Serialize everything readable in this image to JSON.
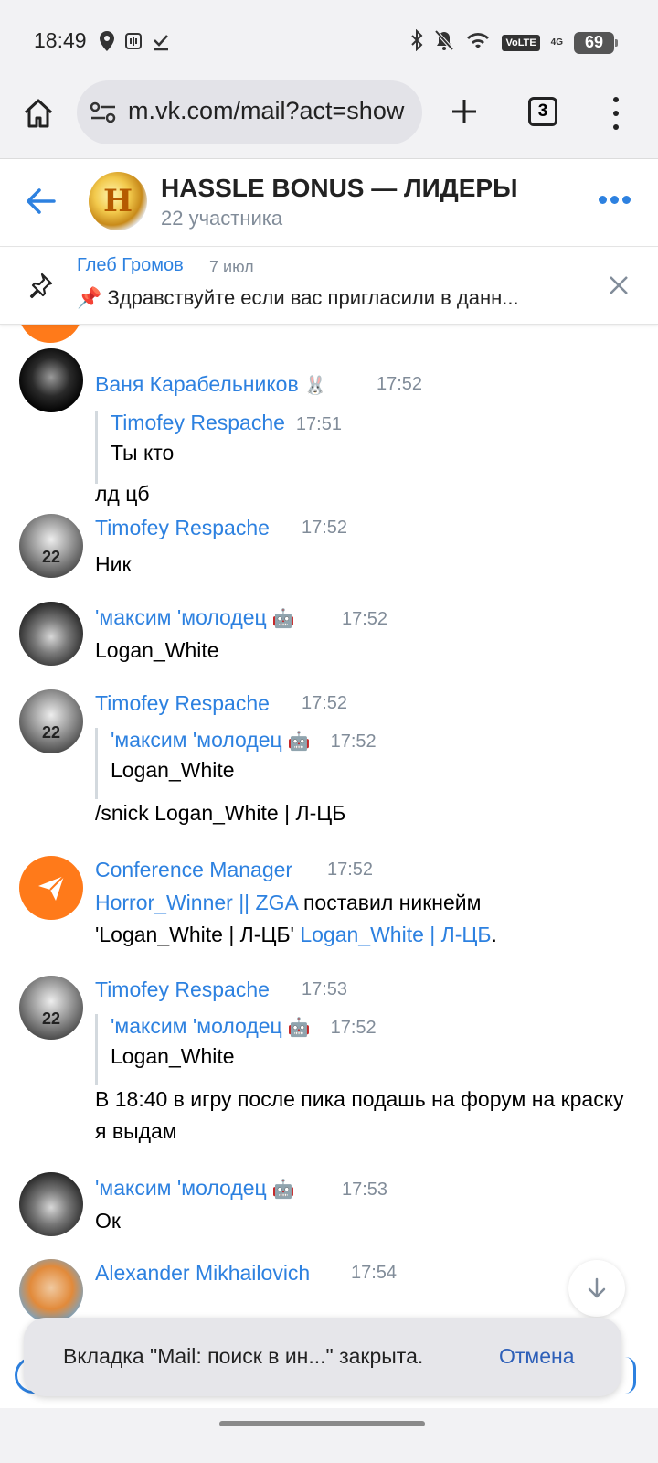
{
  "status_bar": {
    "time": "18:49",
    "volte": "VoLTE",
    "network": "4G",
    "battery": "69"
  },
  "browser": {
    "url": "m.vk.com/mail?act=show",
    "tab_count": "3"
  },
  "chat": {
    "title": "HASSLE BONUS — ЛИДЕРЫ",
    "subtitle": "22 участника",
    "avatar_letter": "H"
  },
  "pinned": {
    "author": "Глеб Громов",
    "date": "7 июл",
    "text": "📌 Здравствуйте если вас пригласили в данн..."
  },
  "messages": [
    {
      "author": "Ваня Карабельников",
      "author_emoji": "🐰",
      "time": "17:52",
      "quote": {
        "author": "Timofey Respache",
        "time": "17:51",
        "text": "Ты кто"
      },
      "text": "лд цб"
    },
    {
      "author": "Timofey Respache",
      "time": "17:52",
      "text": "Ник"
    },
    {
      "author": "'максим 'молодец",
      "author_emoji": "🤖",
      "time": "17:52",
      "text": "Logan_White"
    },
    {
      "author": "Timofey Respache",
      "time": "17:52",
      "quote": {
        "author": "'максим 'молодец",
        "author_emoji": "🤖",
        "time": "17:52",
        "text": "Logan_White"
      },
      "text": "/snick Logan_White | Л-ЦБ"
    },
    {
      "author": "Conference Manager",
      "time": "17:52",
      "link1": "Horror_Winner || ZGA",
      "text_mid": " поставил никнейм",
      "text_line2": "'Logan_White | Л-ЦБ' ",
      "link2": "Logan_White | Л-ЦБ",
      "text_end": "."
    },
    {
      "author": "Timofey Respache",
      "time": "17:53",
      "quote": {
        "author": "'максим 'молодец",
        "author_emoji": "🤖",
        "time": "17:52",
        "text": "Logan_White"
      },
      "text": "В 18:40 в игру после пика подашь на форум на краску я выдам"
    },
    {
      "author": "'максим 'молодец",
      "author_emoji": "🤖",
      "time": "17:53",
      "text": "Ок"
    },
    {
      "author": "Alexander Mikhailovich",
      "time": "17:54"
    }
  ],
  "toast": {
    "text": "Вкладка \"Mail: поиск в ин...\" закрыта.",
    "action": "Отмена"
  },
  "colors": {
    "accent": "#2d81e0",
    "secondary_text": "#818c99",
    "bar_background": "#f2f2f4"
  }
}
